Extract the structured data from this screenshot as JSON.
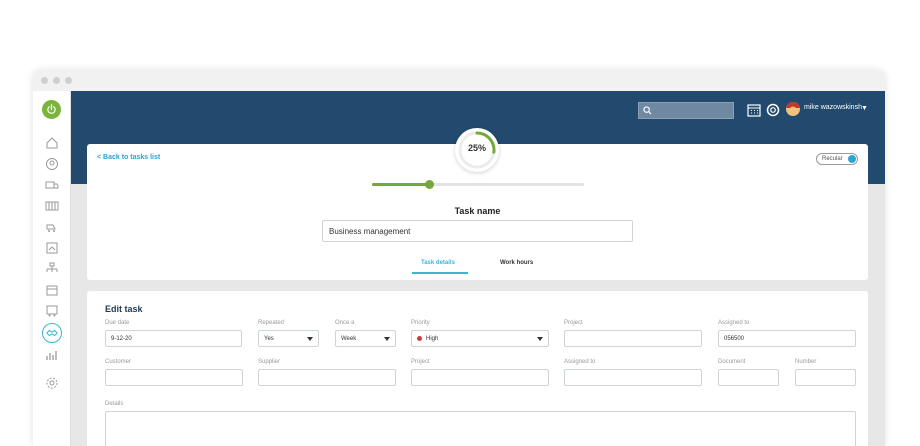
{
  "topbar": {
    "user_name": "mike wazowskinsh",
    "search_placeholder": ""
  },
  "task": {
    "back_link": "< Back to tasks list",
    "progress_label": "25%",
    "progress": 0.27,
    "toggle_label": "Recular",
    "name_label": "Task name",
    "name_value": "Business management",
    "tabs": [
      "Task details",
      "Work hours"
    ]
  },
  "edit": {
    "title": "Edit task",
    "labels": {
      "due_date": "Due date",
      "repeated": "Repeated",
      "once_a": "Once a",
      "priority": "Priority",
      "project": "Project",
      "assigned_to": "Assigned to",
      "customer": "Customer",
      "supplier": "Supplier",
      "project2": "Project",
      "assigned_to2": "Assigned to",
      "document": "Document",
      "number": "Number",
      "details": "Details"
    },
    "values": {
      "due_date": "9-12-20",
      "repeated": "Yes",
      "once_a": "Week",
      "priority": "High",
      "assigned_to": "056500"
    }
  },
  "colors": {
    "topbar": "#224a6e",
    "accent": "#3bb6cf",
    "progress": "#74a838",
    "priority_high": "#d0393e"
  }
}
